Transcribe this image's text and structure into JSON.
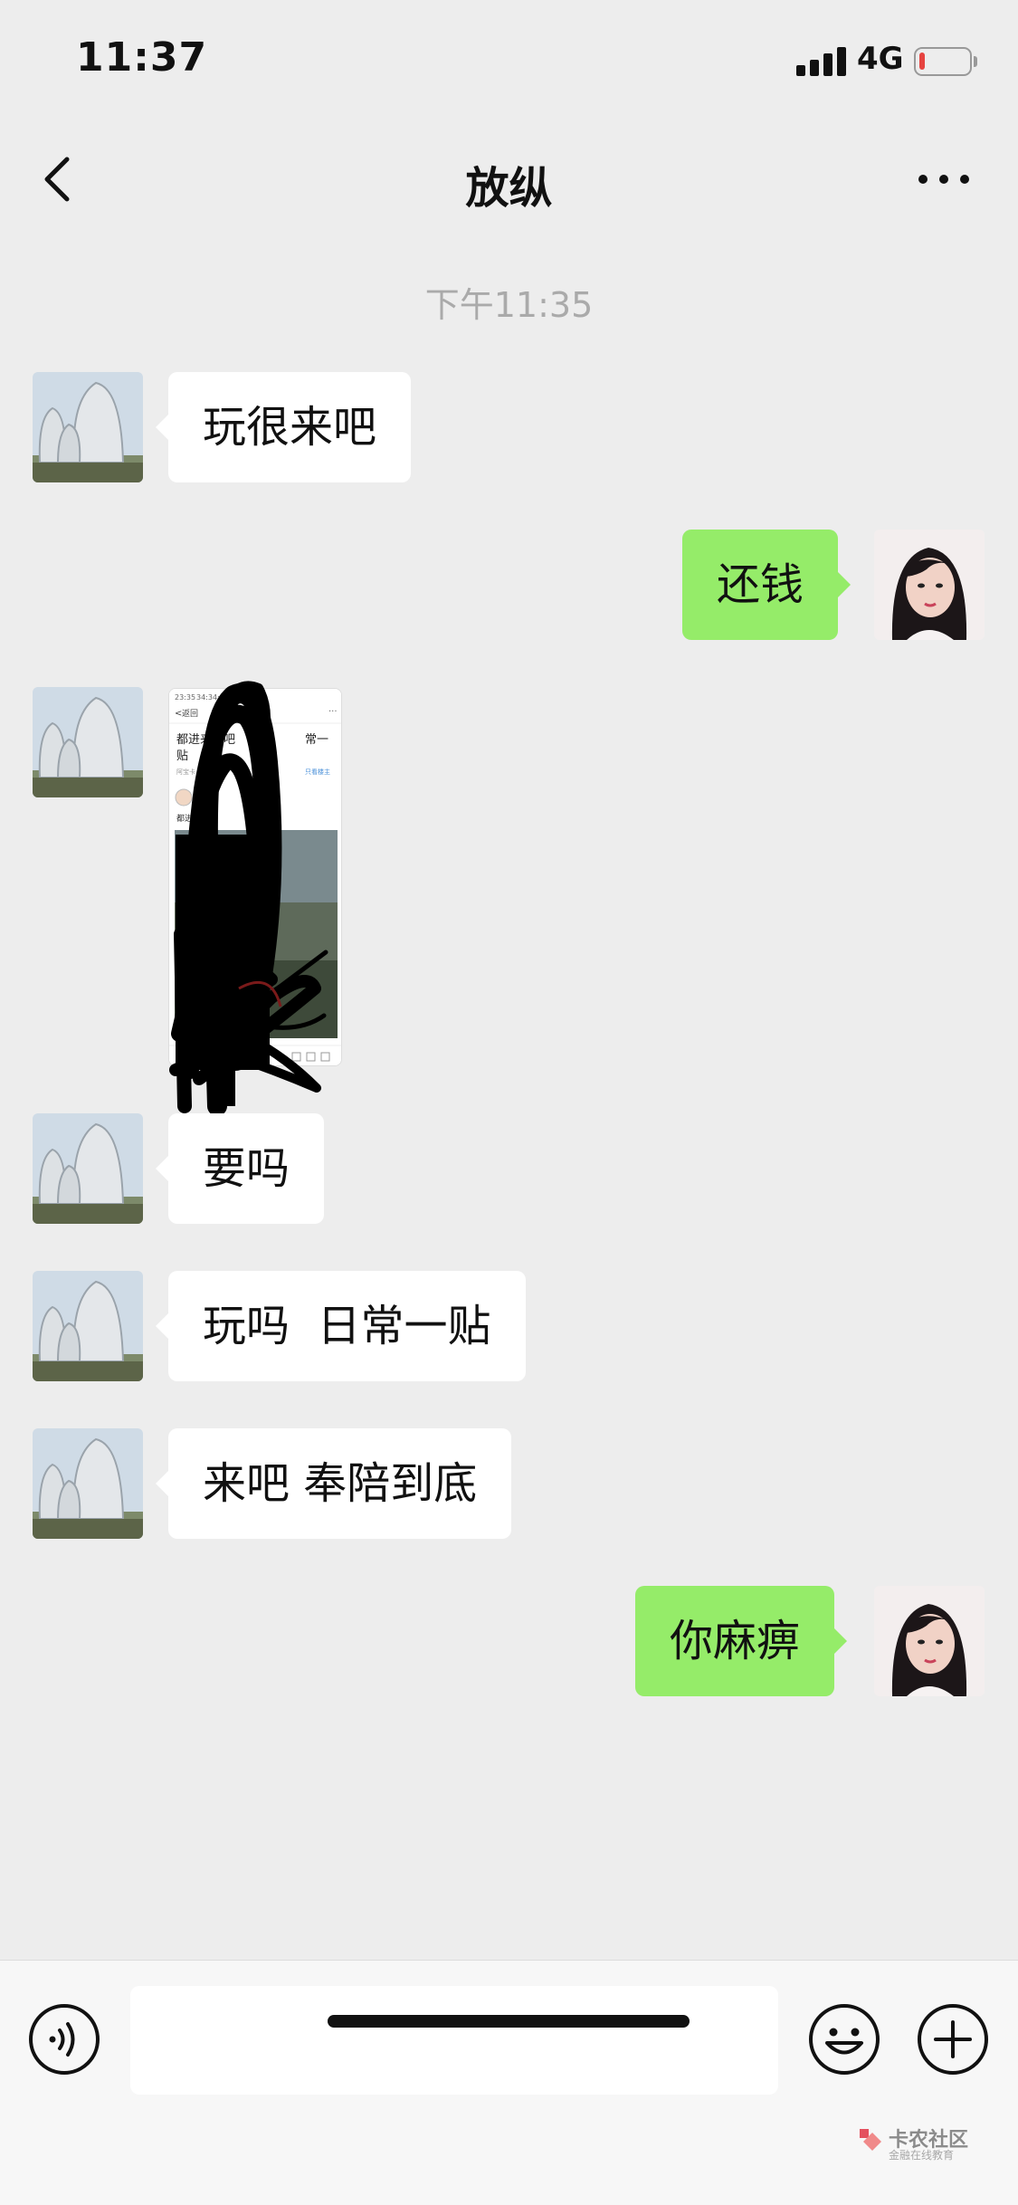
{
  "status_bar": {
    "time": "11:37",
    "network": "4G",
    "battery_level": 0.12,
    "battery_color": "#e64340"
  },
  "nav": {
    "back_icon": "chevron-left-icon",
    "title": "放纵",
    "more_icon": "more-dots-icon"
  },
  "chat": {
    "timestamp": "下午11:35",
    "messages": [
      {
        "side": "left",
        "type": "text",
        "text": "玩很来吧"
      },
      {
        "side": "right",
        "type": "text",
        "text": "还钱"
      },
      {
        "side": "left",
        "type": "image",
        "image": {
          "status_time": "23:35",
          "status_time2": "34:34:51",
          "back_label": "返回",
          "post_title_a": "都进来日吧",
          "post_title_b": "常一",
          "post_title_c": "贴",
          "meta_left": "阿宝卡",
          "meta_mid": "楼数 76",
          "meta_link": "只看楼主",
          "user_label": "放纵",
          "body_text": "都进来",
          "comment_placeholder": "写评论..."
        }
      },
      {
        "side": "left",
        "type": "text",
        "text": "要吗"
      },
      {
        "side": "left",
        "type": "text",
        "text": "玩吗  日常一贴"
      },
      {
        "side": "left",
        "type": "text",
        "text": "来吧 奉陪到底"
      },
      {
        "side": "right",
        "type": "text",
        "text": "你麻痹"
      }
    ]
  },
  "input_bar": {
    "voice_icon": "voice-icon",
    "input_value": "",
    "emoji_icon": "emoji-icon",
    "plus_icon": "plus-icon"
  },
  "watermark": {
    "title": "卡农社区",
    "subtitle": "金融在线教育"
  },
  "colors": {
    "background": "#ededed",
    "bubble_self": "#95ec69",
    "bubble_other": "#ffffff"
  }
}
